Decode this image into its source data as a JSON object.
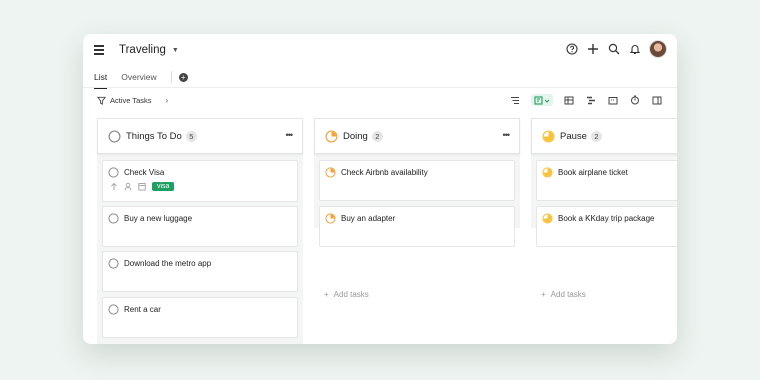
{
  "header": {
    "project_title": "Traveling",
    "icons": [
      "menu-icon",
      "help-icon",
      "plus-icon",
      "search-icon",
      "bell-icon",
      "avatar"
    ]
  },
  "tabs": [
    {
      "label": "List",
      "active": true
    },
    {
      "label": "Overview",
      "active": false
    }
  ],
  "filter": {
    "label": "Active Tasks"
  },
  "toolbar_icons": [
    "sort-icon",
    "board-view-icon",
    "table-view-icon",
    "gantt-icon",
    "calendar-icon",
    "timer-icon",
    "panel-icon"
  ],
  "colors": {
    "accent": "#1f9e62",
    "in_progress": "#f3a33b",
    "paused": "#f7c23c",
    "todo": "#8a8a8a"
  },
  "columns": [
    {
      "title": "Things To Do",
      "count": "5",
      "status": "todo",
      "cards": [
        {
          "name": "Check Visa",
          "tag": "visa"
        },
        {
          "name": "Buy a new luggage"
        },
        {
          "name": "Download the metro app"
        },
        {
          "name": "Rent a car"
        }
      ]
    },
    {
      "title": "Doing",
      "count": "2",
      "status": "doing",
      "cards": [
        {
          "name": "Check Airbnb availability"
        },
        {
          "name": "Buy an adapter"
        }
      ],
      "add_label": "Add tasks"
    },
    {
      "title": "Pause",
      "count": "2",
      "status": "pause",
      "cards": [
        {
          "name": "Book airplane ticket"
        },
        {
          "name": "Book a KKday trip package"
        }
      ],
      "add_label": "Add tasks"
    }
  ]
}
